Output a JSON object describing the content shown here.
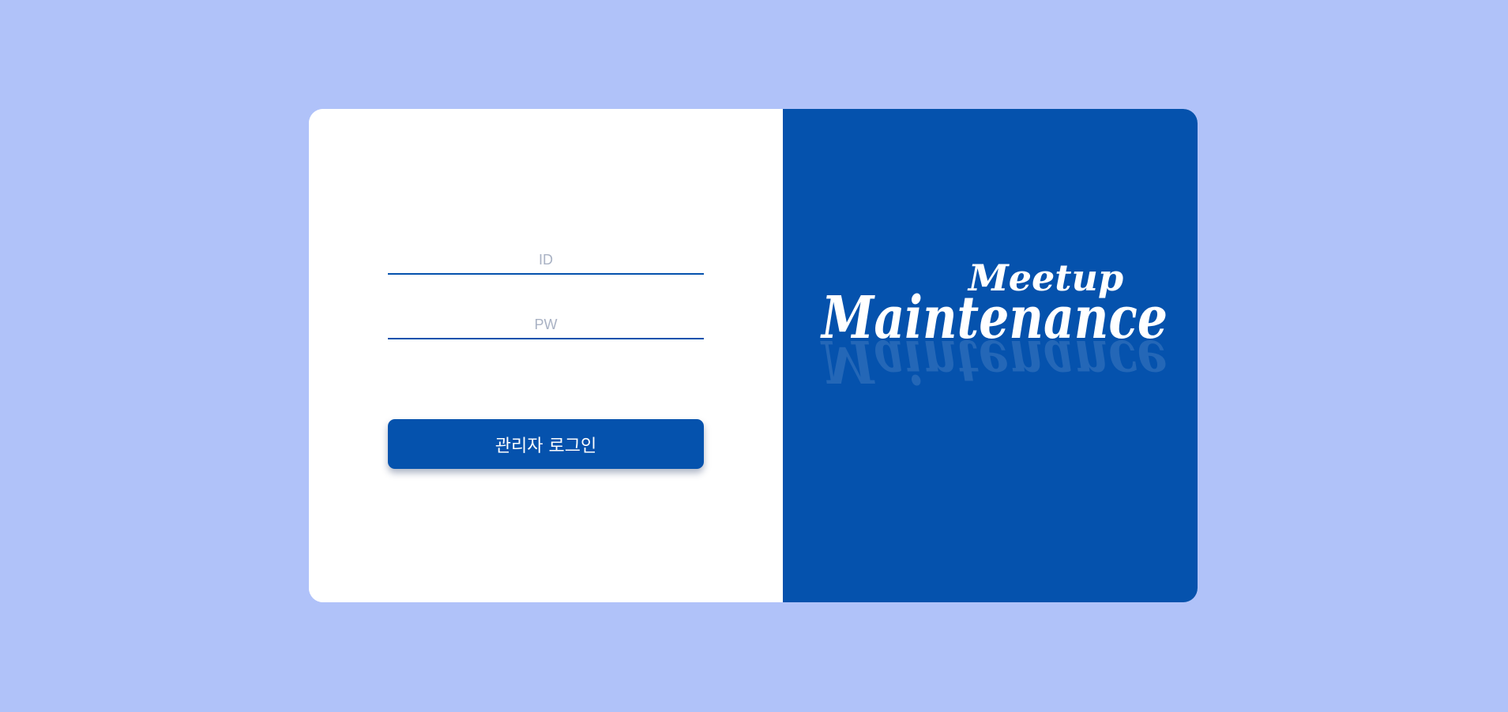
{
  "login_form": {
    "id_placeholder": "ID",
    "pw_placeholder": "PW",
    "submit_label": "관리자 로그인"
  },
  "brand": {
    "top_word": "Meetup",
    "main_word": "Maintenance"
  },
  "colors": {
    "background": "#b0c2f9",
    "primary": "#0552ad",
    "card": "#ffffff",
    "placeholder": "#a9b2c4"
  }
}
